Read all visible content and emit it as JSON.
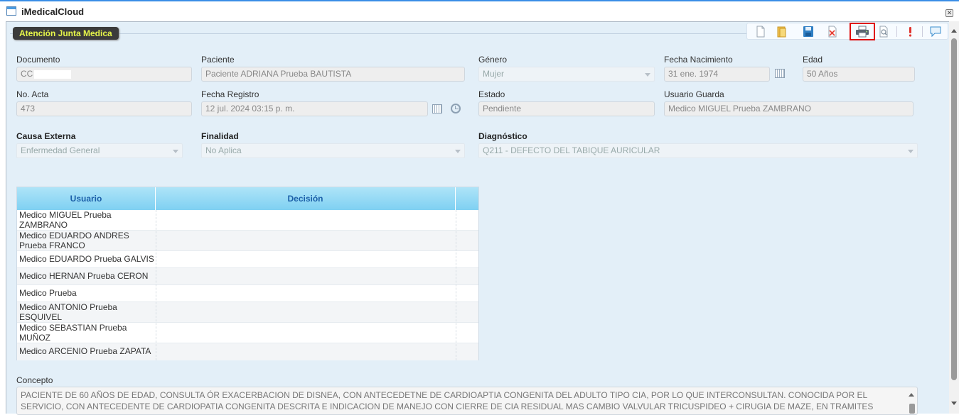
{
  "window": {
    "title": "iMedicalCloud"
  },
  "section": {
    "legend": "Atención Junta Medica"
  },
  "toolbar": {
    "icons": [
      "new-document-icon",
      "open-folder-icon",
      "save-icon",
      "delete-icon",
      "print-icon",
      "preview-icon",
      "alert-icon",
      "comment-icon"
    ],
    "highlighted": "print-icon",
    "highlight_color": "#e00000"
  },
  "form": {
    "documento": {
      "label": "Documento",
      "value": "CC"
    },
    "paciente": {
      "label": "Paciente",
      "value": "Paciente ADRIANA Prueba BAUTISTA"
    },
    "genero": {
      "label": "Género",
      "value": "Mujer"
    },
    "fecha_nacimiento": {
      "label": "Fecha Nacimiento",
      "value": "31 ene. 1974"
    },
    "edad": {
      "label": "Edad",
      "value": "50  Años"
    },
    "no_acta": {
      "label": "No. Acta",
      "value": "473"
    },
    "fecha_registro": {
      "label": "Fecha Registro",
      "value": "12 jul. 2024 03:15 p. m."
    },
    "estado": {
      "label": "Estado",
      "value": "Pendiente"
    },
    "usuario_guarda": {
      "label": "Usuario Guarda",
      "value": "Medico MIGUEL Prueba ZAMBRANO"
    },
    "causa_externa": {
      "label": "Causa Externa",
      "value": "Enfermedad General"
    },
    "finalidad": {
      "label": "Finalidad",
      "value": "No Aplica"
    },
    "diagnostico": {
      "label": "Diagnóstico",
      "value": "Q211 - DEFECTO DEL TABIQUE AURICULAR"
    }
  },
  "grid": {
    "columns": [
      "Usuario",
      "Decisión"
    ],
    "rows": [
      {
        "usuario": "Medico MIGUEL Prueba ZAMBRANO",
        "decision": ""
      },
      {
        "usuario": "Medico EDUARDO ANDRES Prueba FRANCO",
        "decision": ""
      },
      {
        "usuario": "Medico EDUARDO Prueba GALVIS",
        "decision": ""
      },
      {
        "usuario": "Medico HERNAN Prueba CERON",
        "decision": ""
      },
      {
        "usuario": "Medico Prueba",
        "decision": ""
      },
      {
        "usuario": "Medico ANTONIO Prueba ESQUIVEL",
        "decision": ""
      },
      {
        "usuario": "Medico SEBASTIAN Prueba MUÑOZ",
        "decision": ""
      },
      {
        "usuario": "Medico ARCENIO Prueba ZAPATA",
        "decision": ""
      }
    ]
  },
  "concepto": {
    "label": "Concepto",
    "value": "PACIENTE DE 60 AÑOS DE EDAD, CONSULTA ÓR EXACERBACION DE DISNEA, CON ANTECEDETNE DE CARDIOAPTIA CONGENITA DEL ADULTO TIPO CIA, POR LO QUE INTERCONSULTAN. CONOCIDA POR EL SERVICIO, CON ANTECEDENTE DE CARDIOPATIA CONGENITA DESCRITA E INDICACION DE MANEJO CON CIERRE DE CIA RESIDUAL MAS CAMBIO VALVULAR TRICUSPIDEO + CIRUGIA DE MAZE, EN TRAMITES AMDISNITRATIVOS ANTE EPS QUE NO SE"
  }
}
